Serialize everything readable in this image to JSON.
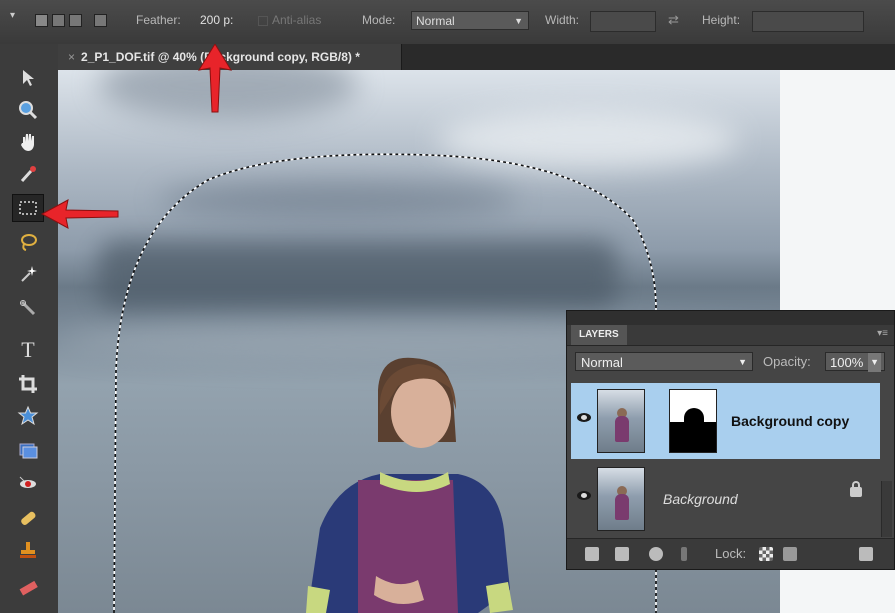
{
  "options_bar": {
    "feather_label": "Feather:",
    "feather_value": "200 p:",
    "anti_alias_label": "Anti-alias",
    "mode_label": "Mode:",
    "mode_value": "Normal",
    "width_label": "Width:",
    "height_label": "Height:"
  },
  "document_tab": {
    "title": "2_P1_DOF.tif @ 40% (Background copy, RGB/8) *",
    "close_glyph": "×"
  },
  "layers_panel": {
    "tab_label": "LAYERS",
    "blend_mode": "Normal",
    "opacity_label": "Opacity:",
    "opacity_value": "100%",
    "layers": [
      {
        "name": "Background copy",
        "selected": true,
        "visible": true,
        "has_mask": true
      },
      {
        "name": "Background",
        "selected": false,
        "visible": true,
        "locked": true
      }
    ],
    "lock_label": "Lock:"
  },
  "toolbox": {
    "tools": [
      "move-tool",
      "zoom-tool",
      "hand-tool",
      "eyedropper-tool",
      "rectangular-marquee-tool",
      "lasso-tool",
      "magic-wand-tool",
      "selection-brush-tool",
      "type-tool",
      "crop-tool",
      "cookie-cutter-tool",
      "straighten-tool",
      "red-eye-tool",
      "healing-brush-tool",
      "clone-stamp-tool",
      "eraser-tool"
    ],
    "active_tool": "rectangular-marquee-tool"
  },
  "colors": {
    "selected_layer": "#a9cfee",
    "annotation_arrow": "#e8242a"
  }
}
